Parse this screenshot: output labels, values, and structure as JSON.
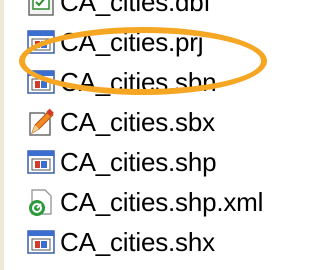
{
  "file_list": {
    "items": [
      {
        "name": "CA_cities.dbf",
        "icon": "dbf-file-icon"
      },
      {
        "name": "CA_cities.prj",
        "icon": "generic-file-icon"
      },
      {
        "name": "CA_cities.sbn",
        "icon": "generic-file-icon"
      },
      {
        "name": "CA_cities.sbx",
        "icon": "edit-file-icon"
      },
      {
        "name": "CA_cities.shp",
        "icon": "generic-file-icon"
      },
      {
        "name": "CA_cities.shp.xml",
        "icon": "xml-file-icon"
      },
      {
        "name": "CA_cities.shx",
        "icon": "generic-file-icon"
      }
    ]
  },
  "annotation": {
    "highlight_color": "#f5a623",
    "highlighted_item": "CA_cities.prj"
  }
}
